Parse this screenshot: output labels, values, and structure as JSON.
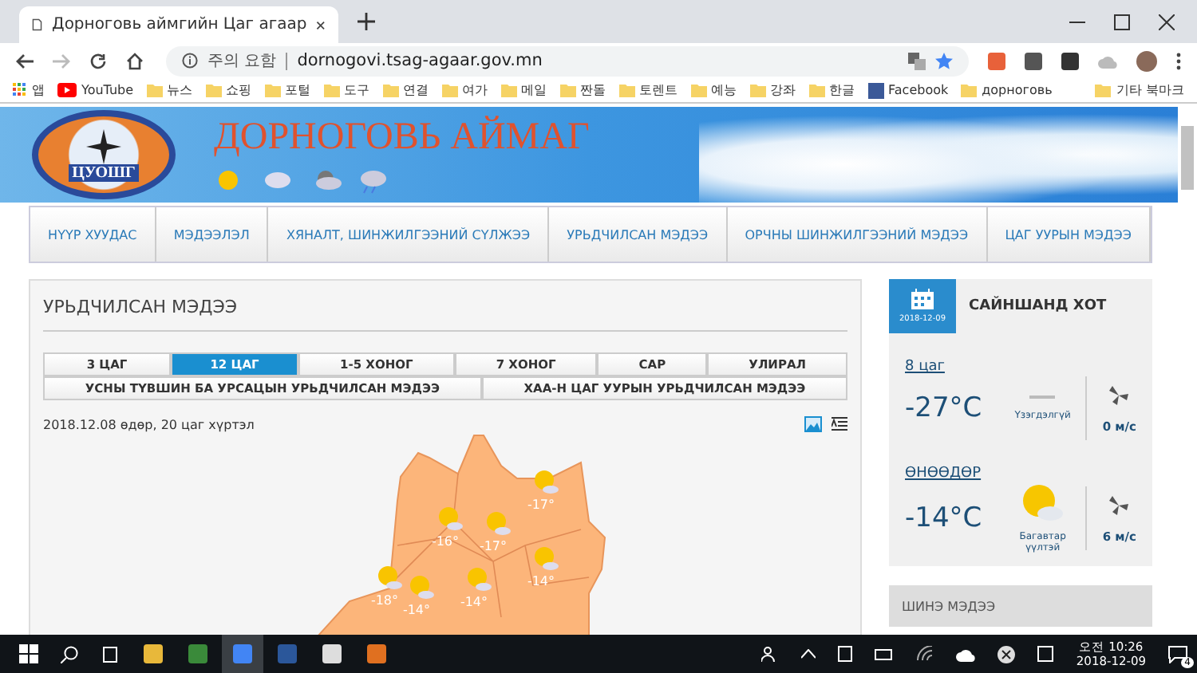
{
  "browser": {
    "tab_title": "Дорноговь аймгийн Цаг агаар",
    "security": "주의 요함",
    "url": "dornogovi.tsag-agaar.gov.mn",
    "bookmarks": [
      {
        "label": "앱",
        "kind": "apps"
      },
      {
        "label": "YouTube",
        "kind": "youtube"
      },
      {
        "label": "뉴스",
        "kind": "folder"
      },
      {
        "label": "쇼핑",
        "kind": "folder"
      },
      {
        "label": "포털",
        "kind": "folder"
      },
      {
        "label": "도구",
        "kind": "folder"
      },
      {
        "label": "연결",
        "kind": "folder"
      },
      {
        "label": "여가",
        "kind": "folder"
      },
      {
        "label": "메일",
        "kind": "folder"
      },
      {
        "label": "짠돌",
        "kind": "folder"
      },
      {
        "label": "토렌트",
        "kind": "folder"
      },
      {
        "label": "예능",
        "kind": "folder"
      },
      {
        "label": "강좌",
        "kind": "folder"
      },
      {
        "label": "한글",
        "kind": "folder"
      },
      {
        "label": "Facebook",
        "kind": "facebook"
      },
      {
        "label": "дорноговь",
        "kind": "folder"
      }
    ],
    "other_bookmarks": "기타 북마크"
  },
  "site": {
    "title": "ДОРНОГОВЬ АЙМАГ",
    "logo_text": "ЦУОШГ",
    "nav": [
      {
        "label": "НҮҮР ХУУДАС"
      },
      {
        "label": "МЭДЭЭЛЭЛ"
      },
      {
        "label": "ХЯНАЛТ, ШИНЖИЛГЭЭНИЙ СҮЛЖЭЭ"
      },
      {
        "label": "УРЬДЧИЛСАН МЭДЭЭ"
      },
      {
        "label": "ОРЧНЫ ШИНЖИЛГЭЭНИЙ МЭДЭЭ"
      },
      {
        "label": "ЦАГ УУРЫН МЭДЭЭ"
      }
    ]
  },
  "forecast": {
    "title": "УРЬДЧИЛСАН МЭДЭЭ",
    "tabs": [
      {
        "label": "3 ЦАГ",
        "selected": false
      },
      {
        "label": "12 ЦАГ",
        "selected": true
      },
      {
        "label": "1-5 ХОНОГ",
        "selected": false
      },
      {
        "label": "7 ХОНОГ",
        "selected": false
      },
      {
        "label": "САР",
        "selected": false
      },
      {
        "label": "УЛИРАЛ",
        "selected": false
      }
    ],
    "tabs_2": [
      {
        "label": "УСНЫ ТҮВШИН БА УРСАЦЫН УРЬДЧИЛСАН МЭДЭЭ"
      },
      {
        "label": "ХАА-Н ЦАГ УУРЫН УРЬДЧИЛСАН МЭДЭЭ"
      }
    ],
    "date_text": "2018.12.08 өдөр, 20 цаг хүртэл",
    "map_labels": [
      "-17°",
      "-16°",
      "-17°",
      "-14°",
      "-18°",
      "-14°",
      "-14°"
    ]
  },
  "sidebar": {
    "date": "2018-12-09",
    "city": "САЙНШАНД ХОТ",
    "rows": [
      {
        "heading": "8 цаг",
        "temp": "-27°C",
        "kind": "none",
        "condition": "Үзэгдэлгүй",
        "wind": "0 м/с"
      },
      {
        "heading": "ӨНӨӨДӨР",
        "temp": "-14°C",
        "kind": "partly-cloudy",
        "condition": "Багавтар үүлтэй",
        "wind": "6 м/с"
      }
    ],
    "news_title": "ШИНЭ МЭДЭЭ"
  },
  "taskbar": {
    "ampm": "오전",
    "time": "10:26",
    "date": "2018-12-09",
    "notifications": "4"
  }
}
